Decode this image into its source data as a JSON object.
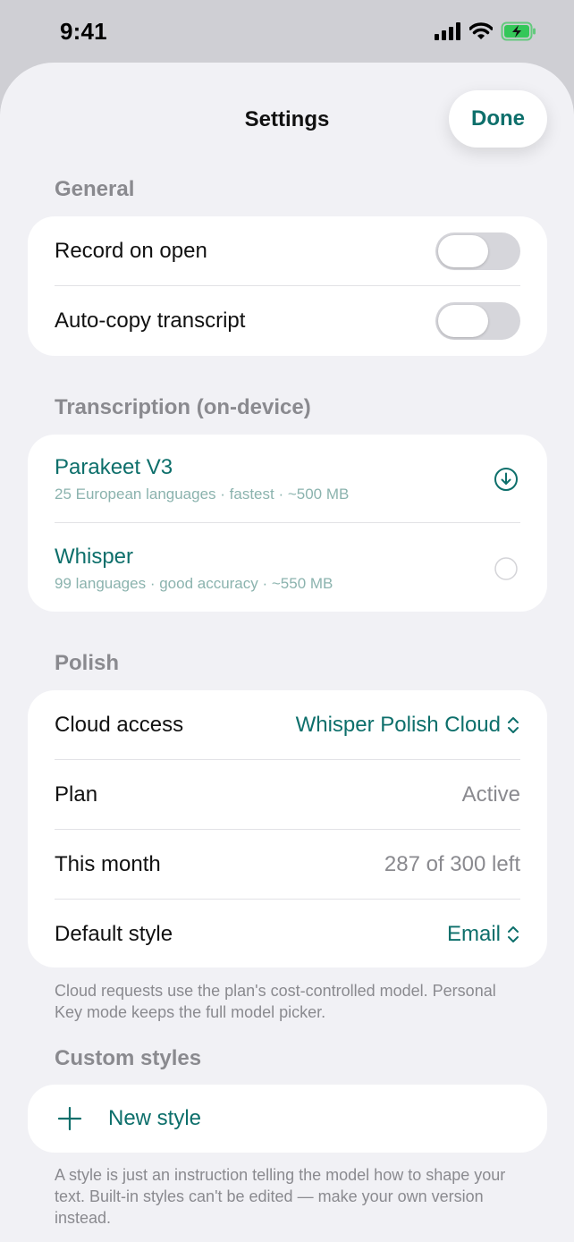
{
  "status_bar": {
    "time": "9:41"
  },
  "nav": {
    "title": "Settings",
    "done_label": "Done"
  },
  "general": {
    "header": "General",
    "record_on_open": {
      "label": "Record on open",
      "on": false
    },
    "auto_copy": {
      "label": "Auto-copy transcript",
      "on": false
    }
  },
  "transcription": {
    "header": "Transcription (on-device)",
    "models": [
      {
        "name": "Parakeet V3",
        "desc": "25 European languages · fastest · ~500 MB",
        "icon": "download-circle-icon"
      },
      {
        "name": "Whisper",
        "desc": "99 languages · good accuracy · ~550 MB",
        "icon": "radio-empty-icon"
      }
    ]
  },
  "polish": {
    "header": "Polish",
    "cloud_access": {
      "label": "Cloud access",
      "value": "Whisper Polish Cloud"
    },
    "plan": {
      "label": "Plan",
      "value": "Active"
    },
    "this_month": {
      "label": "This month",
      "value": "287 of 300 left"
    },
    "default_style": {
      "label": "Default style",
      "value": "Email"
    },
    "footnote": "Cloud requests use the plan's cost-controlled model. Personal Key mode keeps the full model picker."
  },
  "custom_styles": {
    "header": "Custom styles",
    "new_style_label": "New style",
    "footnote": "A style is just an instruction telling the model how to shape your text. Built-in styles can't be edited — make your own version instead."
  },
  "colors": {
    "accent": "#0d6f6b",
    "secondary_text": "#8a8a8f",
    "sheet_bg": "#f1f1f5"
  }
}
